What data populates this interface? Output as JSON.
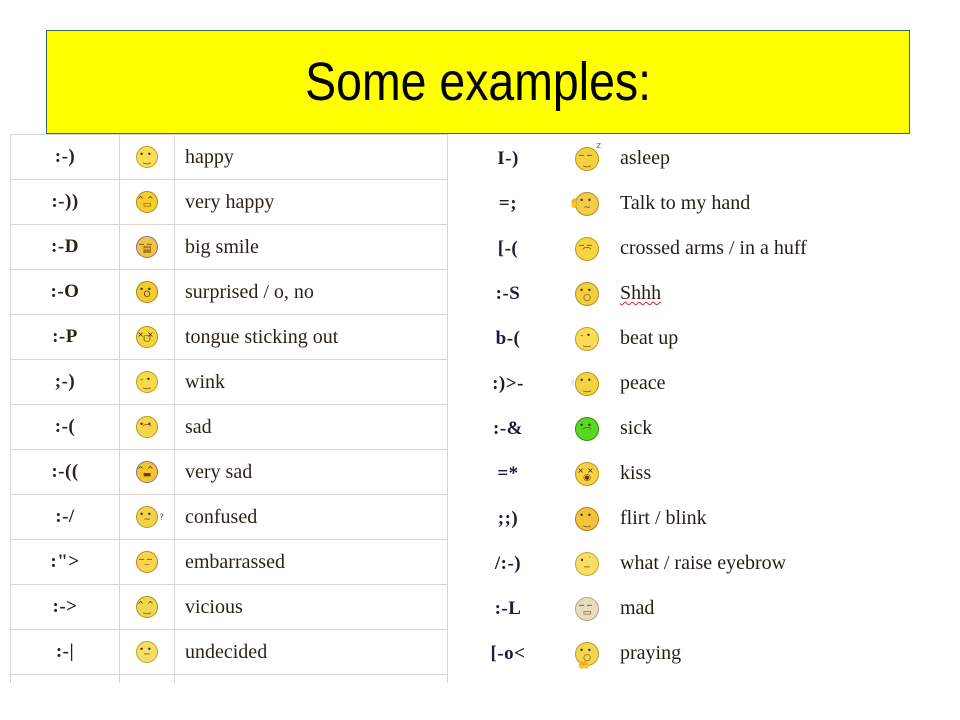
{
  "slide": {
    "title": "Some examples:",
    "background_color": "#ffffff",
    "banner_color": "#FFFF00",
    "banner_border_color": "#2e6b52",
    "title_color": "#000000"
  },
  "left_table": {
    "rows": [
      {
        "code": ":-)",
        "icon": "smiley-happy-icon",
        "description": "happy"
      },
      {
        "code": ":-))",
        "icon": "smiley-very-happy-icon",
        "description": "very happy"
      },
      {
        "code": ":-D",
        "icon": "smiley-big-smile-icon",
        "description": "big smile"
      },
      {
        "code": ":-O",
        "icon": "smiley-surprised-icon",
        "description": "surprised / o, no"
      },
      {
        "code": ":-P",
        "icon": "smiley-tongue-icon",
        "description": "tongue sticking out"
      },
      {
        "code": ";-)",
        "icon": "smiley-wink-icon",
        "description": "wink"
      },
      {
        "code": ":-(",
        "icon": "smiley-sad-icon",
        "description": "sad"
      },
      {
        "code": ":-((",
        "icon": "smiley-very-sad-icon",
        "description": "very sad"
      },
      {
        "code": ":-/",
        "icon": "smiley-confused-icon",
        "description": "confused"
      },
      {
        "code": ":\">",
        "icon": "smiley-embarrassed-icon",
        "description": "embarrassed"
      },
      {
        "code": ":->",
        "icon": "smiley-vicious-icon",
        "description": "vicious"
      },
      {
        "code": ":-|",
        "icon": "smiley-undecided-icon",
        "description": "undecided"
      }
    ]
  },
  "right_table": {
    "rows": [
      {
        "code": "I-)",
        "icon": "smiley-asleep-icon",
        "description": "asleep",
        "misspelled": false
      },
      {
        "code": "=;",
        "icon": "smiley-talk-to-hand-icon",
        "description": "Talk to my hand",
        "misspelled": false
      },
      {
        "code": "[-(",
        "icon": "smiley-crossed-arms-icon",
        "description": "crossed arms / in a huff",
        "misspelled": false
      },
      {
        "code": ":-S",
        "icon": "smiley-shhh-icon",
        "description": "Shhh",
        "misspelled": true
      },
      {
        "code": "b-(",
        "icon": "smiley-beat-up-icon",
        "description": "beat up",
        "misspelled": false
      },
      {
        "code": ":)>-",
        "icon": "smiley-peace-icon",
        "description": "peace",
        "misspelled": false
      },
      {
        "code": ":-&",
        "icon": "smiley-sick-icon",
        "description": "sick",
        "misspelled": false
      },
      {
        "code": "=*",
        "icon": "smiley-kiss-icon",
        "description": "kiss",
        "misspelled": false
      },
      {
        "code": ";;)",
        "icon": "smiley-flirt-icon",
        "description": "flirt / blink",
        "misspelled": false
      },
      {
        "code": "/:-)",
        "icon": "smiley-raise-eyebrow-icon",
        "description": "what / raise eyebrow",
        "misspelled": false
      },
      {
        "code": ":-L",
        "icon": "smiley-mad-icon",
        "description": "mad",
        "misspelled": false
      },
      {
        "code": "[-o<",
        "icon": "smiley-praying-icon",
        "description": "praying",
        "misspelled": false
      }
    ]
  },
  "icon_styles": {
    "smiley-happy-icon": {
      "fill": "#F7DE55",
      "border": "#C79B23",
      "eyes": "••",
      "mouth": "‿",
      "deco": "",
      "deco_color": "",
      "deco_pos": ""
    },
    "smiley-very-happy-icon": {
      "fill": "#F5CE2E",
      "border": "#B8860B",
      "eyes": "^^",
      "mouth": "▭",
      "deco": "",
      "deco_color": "",
      "deco_pos": ""
    },
    "smiley-big-smile-icon": {
      "fill": "#EFC73C",
      "border": "#8A6BA8",
      "eyes": "──",
      "mouth": "▤",
      "deco": "",
      "deco_color": "",
      "deco_pos": ""
    },
    "smiley-surprised-icon": {
      "fill": "#F2CC33",
      "border": "#B07D12",
      "eyes": "••",
      "mouth": "O",
      "deco": "",
      "deco_color": "",
      "deco_pos": ""
    },
    "smiley-tongue-icon": {
      "fill": "#F6D53E",
      "border": "#C08A16",
      "eyes": "××",
      "mouth": "ᗜ",
      "deco": "",
      "deco_color": "",
      "deco_pos": ""
    },
    "smiley-wink-icon": {
      "fill": "#F7DA4A",
      "border": "#C49820",
      "eyes": "-•",
      "mouth": "‿",
      "deco": "",
      "deco_color": "",
      "deco_pos": ""
    },
    "smiley-sad-icon": {
      "fill": "#F5D64B",
      "border": "#BD9320",
      "eyes": "••",
      "mouth": "⌒",
      "deco": "",
      "deco_color": "",
      "deco_pos": ""
    },
    "smiley-very-sad-icon": {
      "fill": "#F3C62B",
      "border": "#8A6BA8",
      "eyes": "^^",
      "mouth": "▬",
      "deco": "",
      "deco_color": "",
      "deco_pos": ""
    },
    "smiley-confused-icon": {
      "fill": "#F1D24A",
      "border": "#B99420",
      "eyes": "••",
      "mouth": "~",
      "deco": "?",
      "deco_color": "#5B4FB5",
      "deco_pos": "right"
    },
    "smiley-embarrassed-icon": {
      "fill": "#F7D64B",
      "border": "#D0762A",
      "eyes": "──",
      "mouth": "⌣",
      "deco": "",
      "deco_color": "",
      "deco_pos": ""
    },
    "smiley-vicious-icon": {
      "fill": "#EFD64F",
      "border": "#A8931F",
      "eyes": "^^",
      "mouth": "‿",
      "deco": "",
      "deco_color": "",
      "deco_pos": ""
    },
    "smiley-undecided-icon": {
      "fill": "#F6DE66",
      "border": "#C2A32D",
      "eyes": "••",
      "mouth": "─",
      "deco": "",
      "deco_color": "",
      "deco_pos": ""
    },
    "smiley-asleep-icon": {
      "fill": "#F4D23F",
      "border": "#BE9522",
      "eyes": "──",
      "mouth": "‿",
      "deco": "z",
      "deco_color": "#2F6FD0",
      "deco_pos": "top"
    },
    "smiley-talk-to-hand-icon": {
      "fill": "#F0CE4A",
      "border": "#B08C20",
      "eyes": "••",
      "mouth": "~",
      "deco": "✋",
      "deco_color": "#E8E2D2",
      "deco_pos": "left"
    },
    "smiley-crossed-arms-icon": {
      "fill": "#F5D63F",
      "border": "#BF9722",
      "eyes": "──",
      "mouth": "⌒",
      "deco": "",
      "deco_color": "",
      "deco_pos": ""
    },
    "smiley-shhh-icon": {
      "fill": "#F1CE3E",
      "border": "#B08E1F",
      "eyes": "••",
      "mouth": "○",
      "deco": "☝",
      "deco_color": "#E4DCC8",
      "deco_pos": "bottom"
    },
    "smiley-beat-up-icon": {
      "fill": "#F8DC55",
      "border": "#C09B23",
      "eyes": "-•",
      "mouth": "‿",
      "deco": "",
      "deco_color": "",
      "deco_pos": ""
    },
    "smiley-peace-icon": {
      "fill": "#F3D342",
      "border": "#B89220",
      "eyes": "••",
      "mouth": "‿",
      "deco": "✌",
      "deco_color": "#D9D2BE",
      "deco_pos": "left"
    },
    "smiley-sick-icon": {
      "fill": "#58D820",
      "border": "#2E8F12",
      "eyes": "••",
      "mouth": "⌒",
      "deco": "",
      "deco_color": "",
      "deco_pos": ""
    },
    "smiley-kiss-icon": {
      "fill": "#F7D23C",
      "border": "#C0901D",
      "eyes": "××",
      "mouth": "◉",
      "deco": "",
      "deco_color": "",
      "deco_pos": ""
    },
    "smiley-flirt-icon": {
      "fill": "#F0C43A",
      "border": "#C07818",
      "eyes": "••",
      "mouth": "‿",
      "deco": "",
      "deco_color": "",
      "deco_pos": ""
    },
    "smiley-raise-eyebrow-icon": {
      "fill": "#F8DE63",
      "border": "#C5A52D",
      "eyes": "•˙",
      "mouth": "─",
      "deco": "",
      "deco_color": "",
      "deco_pos": ""
    },
    "smiley-mad-icon": {
      "fill": "#E8DCBE",
      "border": "#B3A581",
      "eyes": "──",
      "mouth": "▭",
      "deco": "",
      "deco_color": "",
      "deco_pos": ""
    },
    "smiley-praying-icon": {
      "fill": "#F2D64F",
      "border": "#BE9A26",
      "eyes": "••",
      "mouth": "○",
      "deco": "🤲",
      "deco_color": "#E9E2D0",
      "deco_pos": "wrap"
    }
  }
}
